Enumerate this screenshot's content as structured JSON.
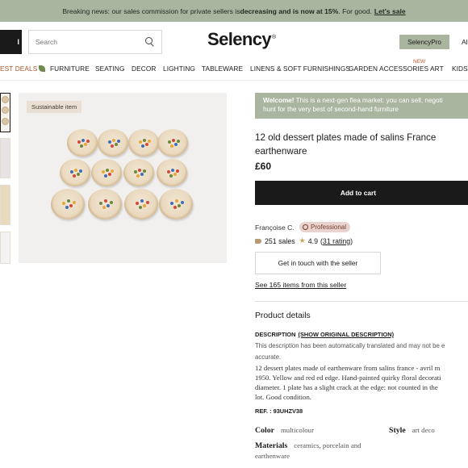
{
  "banner": {
    "prefix": "Breaking news: our sales commission for private sellers is ",
    "emphasis": "decreasing and is now at 15%",
    "suffix": ". For good.",
    "link": "Let's sale"
  },
  "header": {
    "left_button_label": "l",
    "search_placeholder": "Search",
    "logo": "Selency",
    "logo_mark": "®",
    "pro_button": "SelencyPro",
    "right_cut_text": "Al"
  },
  "nav": {
    "items": [
      {
        "label": "EST DEALS"
      },
      {
        "label": "FURNITURE"
      },
      {
        "label": "SEATING"
      },
      {
        "label": "DECOR"
      },
      {
        "label": "LIGHTING"
      },
      {
        "label": "TABLEWARE"
      },
      {
        "label": "LINENS & SOFT FURNISHINGS"
      },
      {
        "label": "GARDEN ACCESSORIES"
      },
      {
        "label": "ART"
      },
      {
        "label": "KIDS"
      }
    ],
    "new_badge": "NEW"
  },
  "gallery": {
    "badge": "Sustainable item"
  },
  "product": {
    "welcome_bold": "Welcome!",
    "welcome_line1": " This is a next-gen flea market: you can sell, negoti",
    "welcome_line2": "hunt for the very best of second-hand furniture",
    "title": "12 old dessert plates made of salins France earthenware",
    "price": "£60",
    "add_to_cart": "Add to cart"
  },
  "seller": {
    "name": "Françoise C.",
    "badge": "Professional",
    "sales": "251 sales",
    "rating": "4.9",
    "rating_count": "31 rating",
    "contact_button": "Get in touch with the seller",
    "see_items": "See 165 items from this seller"
  },
  "details": {
    "title": "Product details",
    "description_label": "DESCRIPTION",
    "original_link": "(SHOW ORIGINAL DESCRIPTION)",
    "auto_note_line1": "This description has been automatically translated and may not be e",
    "auto_note_line2": "accurate.",
    "description_lines": [
      "12 dessert plates made of earthenware from salins france - avril m",
      "1950. Yellow and red ed edge. Hand-painted quirky floral decorati",
      "diameter. 1 plate has a slight crack at the edge: not counted in the",
      "lot. Good condition."
    ],
    "ref": "REF. : 93UHZV38",
    "specs": {
      "color_label": "Color",
      "color_value": "multicolour",
      "style_label": "Style",
      "style_value": "art deco",
      "materials_label": "Materials",
      "materials_value_line1": "ceramics, porcelain and",
      "materials_value_line2": "earthenware"
    }
  },
  "colors": {
    "sage": "#a9b59f",
    "black": "#1a1a1a",
    "deal_orange": "#a35a2a"
  }
}
